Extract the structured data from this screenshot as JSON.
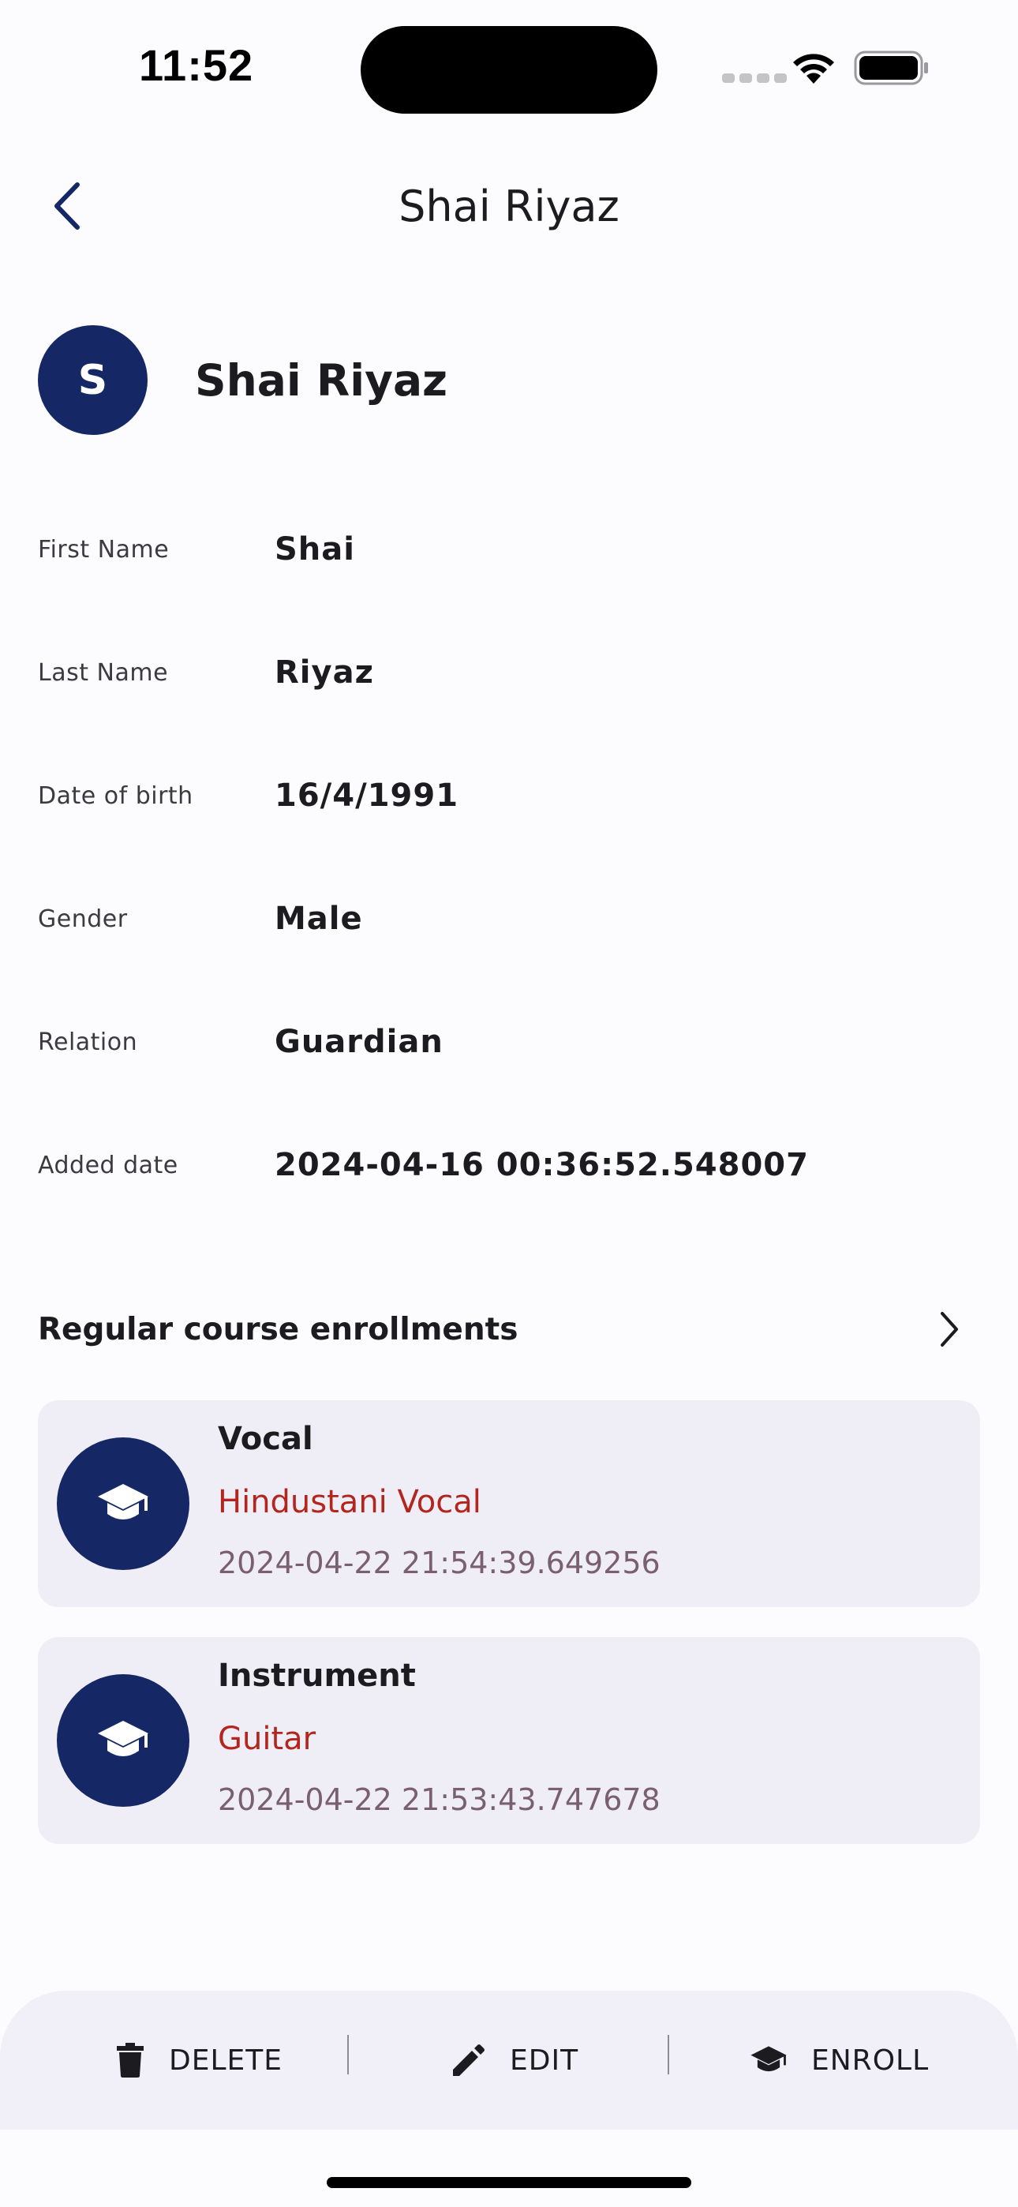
{
  "status_bar": {
    "time": "11:52"
  },
  "header": {
    "title": "Shai Riyaz"
  },
  "profile": {
    "initial": "S",
    "name": "Shai Riyaz"
  },
  "details": [
    {
      "label": "First Name",
      "value": "Shai"
    },
    {
      "label": "Last Name",
      "value": "Riyaz"
    },
    {
      "label": "Date of birth",
      "value": "16/4/1991"
    },
    {
      "label": "Gender",
      "value": "Male"
    },
    {
      "label": "Relation",
      "value": "Guardian"
    },
    {
      "label": "Added date",
      "value": "2024-04-16 00:36:52.548007"
    }
  ],
  "enrollments": {
    "title": "Regular course enrollments",
    "items": [
      {
        "category": "Vocal",
        "course": "Hindustani Vocal",
        "date": "2024-04-22 21:54:39.649256",
        "icon": "graduation-cap-icon"
      },
      {
        "category": "Instrument",
        "course": "Guitar",
        "date": "2024-04-22 21:53:43.747678",
        "icon": "graduation-cap-icon"
      }
    ]
  },
  "actions": {
    "delete_label": "DELETE",
    "edit_label": "EDIT",
    "enroll_label": "ENROLL"
  },
  "colors": {
    "primary": "#162766",
    "course_name": "#b3261e",
    "date_text": "#7a5f6f",
    "card_bg": "#efeef6"
  }
}
